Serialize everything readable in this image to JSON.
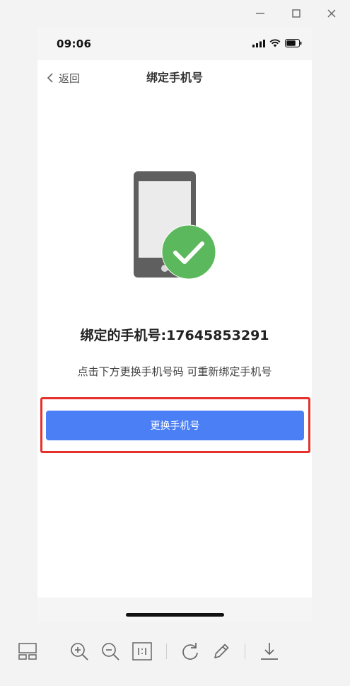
{
  "window": {
    "controls": [
      "minimize-icon",
      "maximize-icon",
      "close-icon"
    ]
  },
  "status_bar": {
    "time": "09:06",
    "icons": [
      "signal-icon",
      "wifi-icon",
      "battery-icon"
    ]
  },
  "nav": {
    "back_label": "返回",
    "title": "绑定手机号"
  },
  "content": {
    "bound_label": "绑定的手机号:17645853291",
    "hint": "点击下方更换手机号码 可重新绑定手机号",
    "change_button": "更换手机号",
    "illustration": "phone-check-icon"
  },
  "toolbar": {
    "items": [
      "layout-icon",
      "zoom-in-icon",
      "zoom-out-icon",
      "actual-size-icon",
      "rotate-icon",
      "edit-icon",
      "download-icon"
    ]
  },
  "colors": {
    "accent": "#4b7ff5",
    "highlight": "#e5302b",
    "success": "#5cb85c",
    "phone_body": "#5f5f5f"
  }
}
